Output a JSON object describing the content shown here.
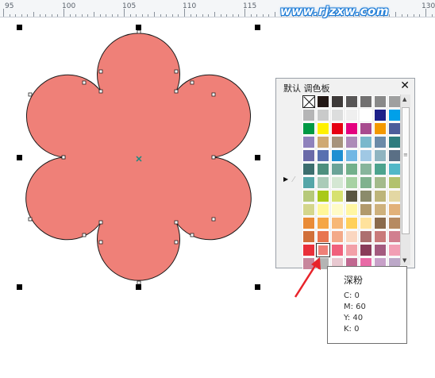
{
  "ruler": {
    "labels": [
      {
        "id": "r95",
        "text": "95"
      },
      {
        "id": "r100",
        "text": "100"
      },
      {
        "id": "r105",
        "text": "105"
      },
      {
        "id": "r110",
        "text": "110"
      },
      {
        "id": "r115",
        "text": "115"
      },
      {
        "id": "r130",
        "text": "130"
      }
    ]
  },
  "watermark": "www.rjzxw.com",
  "canvas": {
    "shape_fill": "#EF8078",
    "shape_stroke": "#1a1a1a",
    "center_marker_color": "#1a8a80"
  },
  "palette": {
    "title": "默认 调色板",
    "close_label": "✕",
    "side_arrow": "▶",
    "eyedropper_icon": "eyedropper-icon",
    "scroll_up": "▲",
    "scroll_down": "▼",
    "scroll_grip": "≡",
    "rows": [
      [
        "nofill",
        "#231815",
        "#3e3a39",
        "#595757",
        "#727171",
        "#898989",
        "#9fa0a0"
      ],
      [
        "#b5b5b6",
        "#c9caca",
        "#dcdddd",
        "#efefef",
        "#ffffff",
        "#1d2088",
        "#00a0e9"
      ],
      [
        "#009944",
        "#fff100",
        "#e60012",
        "#e4007f",
        "#a84c8f",
        "#f39800",
        "#4d5d9b"
      ],
      [
        "#8f82bc",
        "#cfa972",
        "#a6937c",
        "#ad8ab8",
        "#7ab8cc",
        "#6a8aa8",
        "#2e7d7f"
      ],
      [
        "#6a6aa8",
        "#5870b0",
        "#1e8fd2",
        "#71b7e4",
        "#a0c8e4",
        "#8fb4c0",
        "#5a6f85"
      ],
      [
        "#3c6e6e",
        "#4d8f7e",
        "#6ba398",
        "#72b08b",
        "#87b59c",
        "#4ca38e",
        "#52b8c8"
      ],
      [
        "#55a6a8",
        "#aacbb8",
        "#d4e7d3",
        "#a7d2a3",
        "#7fb28e",
        "#a3ba8b",
        "#b2c26e"
      ],
      [
        "#b6c97a",
        "#a9c919",
        "#d7e170",
        "#595541",
        "#8b8b6b",
        "#bdb57a",
        "#e3d7a3"
      ],
      [
        "#d4d68c",
        "#fff799",
        "#fffbc7",
        "#fff6a3",
        "#b29a6c",
        "#ceb17d",
        "#e2b17a"
      ],
      [
        "#e98b37",
        "#f5a646",
        "#f7b776",
        "#ffd05a",
        "#ffe29c",
        "#8a6a4c",
        "#b68a62"
      ],
      [
        "#d1703a",
        "#e8754f",
        "#f3a988",
        "#fad6c0",
        "#ad6f6f",
        "#c97a7a",
        "#d17f8f"
      ],
      [
        "#e9303a",
        "#EF8078",
        "#f0617c",
        "#f2a0a8",
        "#8a3c5a",
        "#a35a7e",
        "#f29eb4"
      ],
      [
        "#c8869c",
        "#b4b4b4",
        "#e8c8d0",
        "#c06890",
        "#e86aa6",
        "#c7a0c8",
        "#bca8c8"
      ]
    ],
    "selected": {
      "row": 11,
      "col": 1
    }
  },
  "tooltip": {
    "name": "深粉",
    "c": "C: 0",
    "m": "M: 60",
    "y": "Y: 40",
    "k": "K: 0"
  },
  "annotation_arrow_color": "#e8232a"
}
